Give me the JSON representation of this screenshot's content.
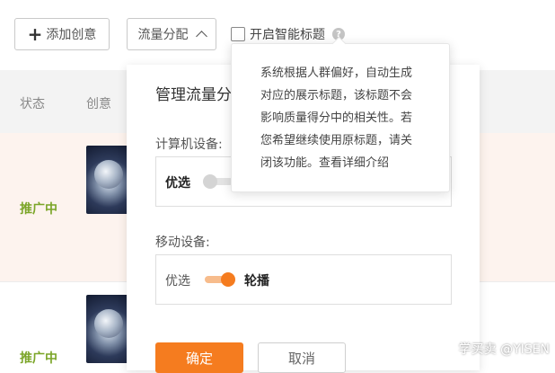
{
  "toolbar": {
    "add_creative_label": "添加创意",
    "traffic_allocation_label": "流量分配",
    "smart_title_label": "开启智能标题",
    "help_glyph": "?"
  },
  "table": {
    "columns": [
      "状态",
      "创意"
    ],
    "rows": [
      {
        "status": "推广中"
      },
      {
        "status": "推广中"
      }
    ]
  },
  "modal": {
    "title": "管理流量分配",
    "desktop_label": "计算机设备:",
    "desktop_option_label": "优选",
    "desktop_toggle_on": false,
    "mobile_label": "移动设备:",
    "mobile_option_left": "优选",
    "mobile_option_right": "轮播",
    "mobile_toggle_on": true,
    "confirm_label": "确定",
    "cancel_label": "取消"
  },
  "tooltip": {
    "text": "系统根据人群偏好，自动生成\n对应的展示标题，该标题不会\n影响质量得分中的相关性。若\n您希望继续使用原标题，请关\n闭该功能。查看详细介绍"
  },
  "watermark": "学买卖 @YISEN",
  "colors": {
    "accent_orange": "#f57c1f",
    "status_green": "#7ba528",
    "row_highlight": "#fdf3ee"
  }
}
